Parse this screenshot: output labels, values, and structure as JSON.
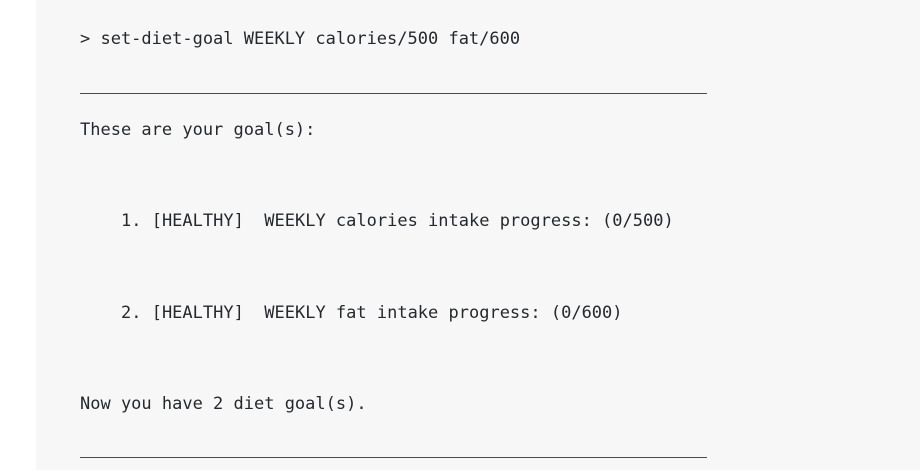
{
  "terminal": {
    "command": "> set-diet-goal WEEKLY calories/500 fat/600",
    "header": "These are your goal(s):",
    "goals": [
      "1. [HEALTHY]  WEEKLY calories intake progress: (0/500)",
      "2. [HEALTHY]  WEEKLY fat intake progress: (0/600)"
    ],
    "footer": "Now you have 2 diet goal(s)."
  }
}
